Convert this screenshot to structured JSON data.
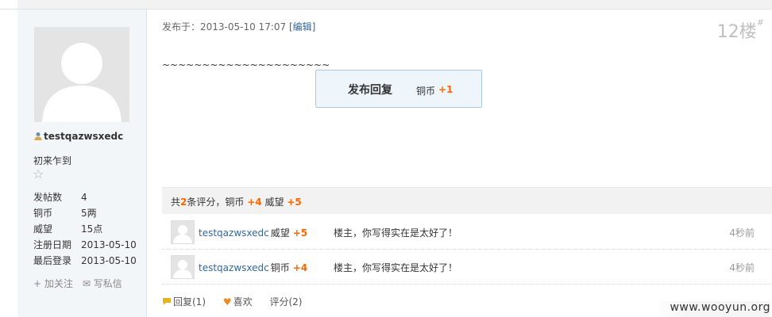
{
  "author": {
    "username": "testqazwsxedc",
    "rank": "初来乍到",
    "stats": [
      {
        "key": "发帖数",
        "value": "4"
      },
      {
        "key": "铜币",
        "value": "5两"
      },
      {
        "key": "威望",
        "value": "15点"
      },
      {
        "key": "注册日期",
        "value": "2013-05-10"
      },
      {
        "key": "最后登录",
        "value": "2013-05-10"
      }
    ],
    "follow_label": "+ 加关注",
    "message_label": "✉ 写私信"
  },
  "post": {
    "meta_prefix": "发布于：2013-05-10 17:07",
    "edit_label": "[编辑]",
    "floor": "12楼",
    "floor_mark": "#",
    "content": "~~~~~~~~~~~~~~~~~~~~~",
    "reply_notice": {
      "title": "发布回复",
      "reward_label": "铜币",
      "reward_value": "+1"
    }
  },
  "ratings": {
    "summary_prefix": "共",
    "summary_count": "2",
    "summary_suffix": "条评分，",
    "summary_item1": "铜币",
    "summary_value1": "+4",
    "summary_item2": "威望",
    "summary_value2": "+5",
    "rows": [
      {
        "user": "testqazwsxedc",
        "item": "威望",
        "value": "+5",
        "comment": "楼主，你写得实在是太好了！",
        "time": "4秒前"
      },
      {
        "user": "testqazwsxedc",
        "item": "铜币",
        "value": "+4",
        "comment": "楼主，你写得实在是太好了！",
        "time": "4秒前"
      }
    ]
  },
  "footer": {
    "reply": "回复(1)",
    "like": "喜欢",
    "rate": "评分(2)"
  },
  "watermark": "www.wooyun.org",
  "colors": {
    "accent": "#ff6600",
    "link": "#336699",
    "sidebar_bg": "#f3f6f8"
  }
}
